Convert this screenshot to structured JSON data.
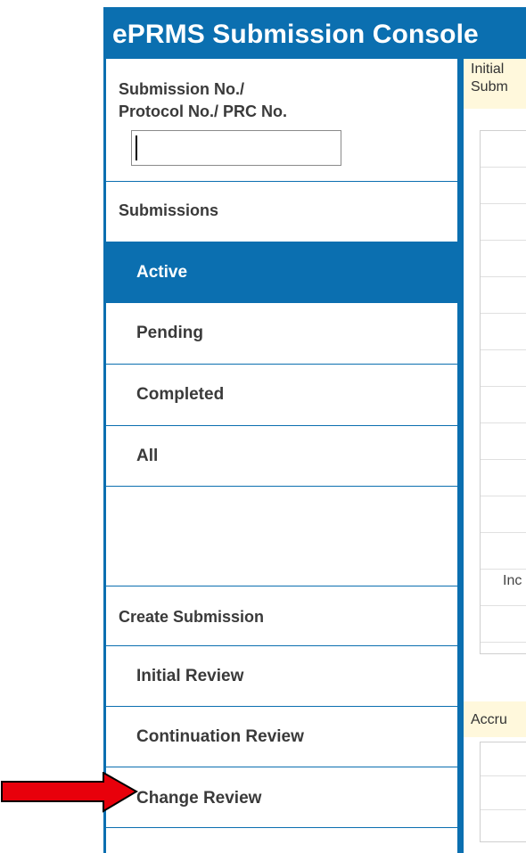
{
  "header": {
    "title": "ePRMS Submission Console"
  },
  "search": {
    "label_line1": "Submission No./",
    "label_line2": "Protocol No./ PRC No.",
    "value": "",
    "placeholder": ""
  },
  "nav": {
    "submissions_heading": "Submissions",
    "active": "Active",
    "pending": "Pending",
    "completed": "Completed",
    "all": "All",
    "create_heading": "Create Submission",
    "initial_review": "Initial Review",
    "continuation_review": "Continuation Review",
    "change_review": "Change Review"
  },
  "main": {
    "panel1_line1": "Initial",
    "panel1_line2": "Subm",
    "row_label": "Inc",
    "panel2_head": "Accru"
  },
  "colors": {
    "brand_blue": "#0b6fb0",
    "panel_header": "#fff8dc",
    "annotation_arrow": "#e8000b"
  }
}
